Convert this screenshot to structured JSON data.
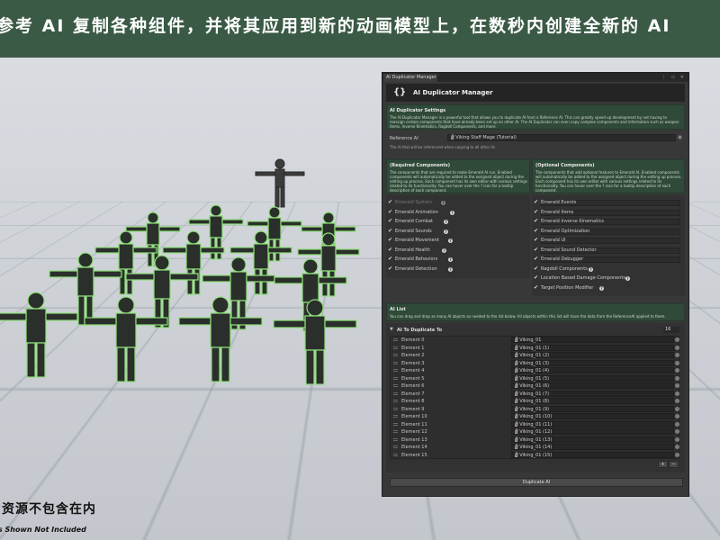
{
  "banner": {
    "text": "参考 AI 复制各种组件，并将其应用到新的动画模型上，在数秒内创建全新的 AI"
  },
  "captions": {
    "cn": "资源不包含在内",
    "en": "s Shown Not Included"
  },
  "window": {
    "tab_label": "AI Duplicator Manager",
    "tab_icons": "⋮ ▭ ✕",
    "header_title": "AI Duplicator Manager",
    "settings": {
      "title": "AI Duplicator Settings",
      "description": "The AI Duplicator Manager is a powerful tool that allows you to duplicate AI from a Reference AI. This can greatly speed up development by not having to reassign certain components that have already been set up on other AI. The AI Duplicator can even copy complex components and information such as weapon items, Inverse Kinematics, Ragdoll Components, and more."
    },
    "reference_ai": {
      "label": "Reference AI",
      "value": "🗿Viking Staff Mage (Tutorial)",
      "help": "The AI that will be referenced when copying to all other AI."
    },
    "required": {
      "title": "(Required Components)",
      "description": "The components that are required to make Emerald AI run. Enabled components will automatically be added to the assigned object during the setting up process. Each component has its own editor with various settings related to its functionality. You can hover over the ? icon for a tooltip description of each component.",
      "items": [
        {
          "label": "Emerald System",
          "check": "✔",
          "disabled": true
        },
        {
          "label": "Emerald Animation",
          "check": "✔"
        },
        {
          "label": "Emerald Combat",
          "check": "✔"
        },
        {
          "label": "Emerald Sounds",
          "check": "✔"
        },
        {
          "label": "Emerald Movement",
          "check": "✔"
        },
        {
          "label": "Emerald Health",
          "check": "✔"
        },
        {
          "label": "Emerald Behaviors",
          "check": "✔"
        },
        {
          "label": "Emerald Detection",
          "check": "✔"
        }
      ]
    },
    "optional": {
      "title": "(Optional Components)",
      "description": "The components that add optional features to Emerald AI. Enabled components will automatically be added to the assigned object during the setting up process. Each component has its own editor with various settings related to its functionality. You can hover over the ? icon for a tooltip description of each component.",
      "items": [
        {
          "label": "Emerald Events",
          "check": "✔"
        },
        {
          "label": "Emerald Items",
          "check": "✔"
        },
        {
          "label": "Emerald Inverse Kinematics",
          "check": "✔"
        },
        {
          "label": "Emerald Optimization",
          "check": "✔"
        },
        {
          "label": "Emerald UI",
          "check": "✔"
        },
        {
          "label": "Emerald Sound Detector",
          "check": "✔"
        },
        {
          "label": "Emerald Debugger",
          "check": "✔"
        },
        {
          "label": "Ragdoll Components",
          "check": "✔"
        },
        {
          "label": "Location Based Damage Components",
          "check": "✔"
        },
        {
          "label": "Target Position Modifier",
          "check": "✔"
        }
      ]
    },
    "ai_list": {
      "title": "AI List",
      "description": "You can drag and drop as many AI objects as needed to the list below. All objects within this list will have the data from the ReferenceAI applied to them.",
      "header_label": "AI To Duplicate To",
      "count": "16",
      "elements": [
        {
          "label": "Element 0",
          "value": "🗿Viking_01"
        },
        {
          "label": "Element 1",
          "value": "🗿Viking_01 (1)"
        },
        {
          "label": "Element 2",
          "value": "🗿Viking_01 (2)"
        },
        {
          "label": "Element 3",
          "value": "🗿Viking_01 (3)"
        },
        {
          "label": "Element 4",
          "value": "🗿Viking_01 (4)"
        },
        {
          "label": "Element 5",
          "value": "🗿Viking_01 (5)"
        },
        {
          "label": "Element 6",
          "value": "🗿Viking_01 (6)"
        },
        {
          "label": "Element 7",
          "value": "🗿Viking_01 (7)"
        },
        {
          "label": "Element 8",
          "value": "🗿Viking_01 (8)"
        },
        {
          "label": "Element 9",
          "value": "🗿Viking_01 (9)"
        },
        {
          "label": "Element 10",
          "value": "🗿Viking_01 (10)"
        },
        {
          "label": "Element 11",
          "value": "🗿Viking_01 (11)"
        },
        {
          "label": "Element 12",
          "value": "🗿Viking_01 (12)"
        },
        {
          "label": "Element 13",
          "value": "🗿Viking_01 (13)"
        },
        {
          "label": "Element 14",
          "value": "🗿Viking_01 (14)"
        },
        {
          "label": "Element 15",
          "value": "🗿Viking_01 (15)"
        }
      ],
      "add_label": "+",
      "remove_label": "−"
    },
    "duplicate_button": "Duplicate AI"
  },
  "colors": {
    "banner": "#3a5a45",
    "section_green": "#2f4a38",
    "window_bg": "#383838",
    "figure_outline": "#8ee07a"
  }
}
